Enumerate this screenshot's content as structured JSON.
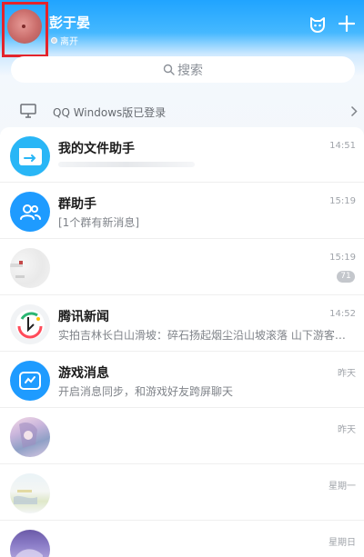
{
  "header": {
    "user_name": "彭于晏",
    "status": "离开"
  },
  "search": {
    "placeholder": "搜索"
  },
  "pc_login": {
    "text": "QQ Windows版已登录"
  },
  "chats": [
    {
      "title": "我的文件助手",
      "subtitle": "",
      "time": "14:51",
      "badge": ""
    },
    {
      "title": "群助手",
      "subtitle": "[1个群有新消息]",
      "time": "15:19",
      "badge": ""
    },
    {
      "title": "",
      "subtitle": "",
      "time": "15:19",
      "badge": "71"
    },
    {
      "title": "腾讯新闻",
      "subtitle": "实拍吉林长白山滑坡：碎石扬起烟尘沿山坡滚落 山下游客…",
      "time": "14:52",
      "badge": ""
    },
    {
      "title": "游戏消息",
      "subtitle": "开启消息同步，和游戏好友跨屏聊天",
      "time": "昨天",
      "badge": ""
    },
    {
      "title": "",
      "subtitle": "",
      "time": "昨天",
      "badge": ""
    },
    {
      "title": "",
      "subtitle": "",
      "time": "星期一",
      "badge": ""
    },
    {
      "title": "",
      "subtitle": "",
      "time": "星期日",
      "badge": ""
    }
  ],
  "colors": {
    "accent": "#1e9bff",
    "highlight_box": "#e3242b"
  },
  "icons": [
    "cat-icon",
    "plus-icon",
    "search-icon",
    "monitor-icon",
    "chevron-right-icon",
    "file-assistant-icon",
    "group-assistant-icon",
    "news-icon",
    "game-icon"
  ]
}
